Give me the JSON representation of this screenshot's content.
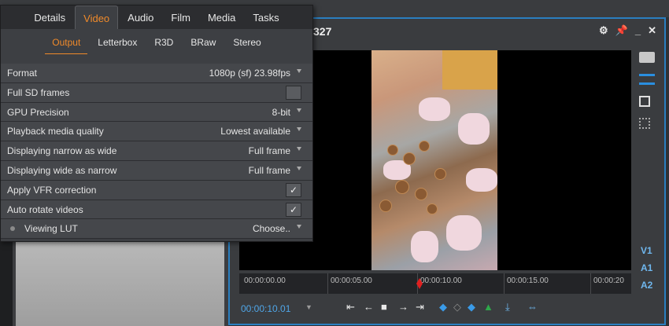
{
  "viewer": {
    "title": "327",
    "timecode": "00:00:10.01",
    "timeline_ticks": [
      "00:00:00.00",
      "00:00:05.00",
      "00:00:10.00",
      "00:00:15.00",
      "00:00:20"
    ],
    "tracks": [
      "V1",
      "A1",
      "A2"
    ],
    "transport_icons": [
      "go-to-start-icon",
      "step-back-icon",
      "stop-icon",
      "step-forward-icon",
      "go-to-end-icon",
      "mark-in-icon",
      "mark-out-icon",
      "marker-icon",
      "insert-icon",
      "overwrite-icon"
    ],
    "header_icons": [
      "gear-icon",
      "pin-icon",
      "minimize-icon",
      "close-icon"
    ]
  },
  "settings": {
    "tabs": [
      {
        "label": "Details"
      },
      {
        "label": "Video"
      },
      {
        "label": "Audio"
      },
      {
        "label": "Film"
      },
      {
        "label": "Media"
      },
      {
        "label": "Tasks"
      }
    ],
    "active_tab": "Video",
    "subtabs": [
      {
        "label": "Output"
      },
      {
        "label": "Letterbox"
      },
      {
        "label": "R3D"
      },
      {
        "label": "BRaw"
      },
      {
        "label": "Stereo"
      }
    ],
    "active_subtab": "Output",
    "rows": [
      {
        "label": "Format",
        "value": "1080p (sf) 23.98fps"
      },
      {
        "label": "Full SD frames",
        "checked": false
      },
      {
        "label": "GPU Precision",
        "value": "8-bit"
      },
      {
        "label": "Playback media quality",
        "value": "Lowest available"
      },
      {
        "label": "Displaying narrow as wide",
        "value": "Full frame"
      },
      {
        "label": "Displaying wide as narrow",
        "value": "Full frame"
      },
      {
        "label": "Apply VFR correction",
        "checked": true,
        "check_glyph": "✓"
      },
      {
        "label": "Auto rotate videos",
        "checked": true,
        "check_glyph": "✓"
      },
      {
        "label": "Viewing LUT",
        "value": "Choose.."
      }
    ]
  },
  "colors": {
    "accent": "#f08a2a",
    "viewer_border": "#2a7fc0",
    "timecode": "#4fa6e8",
    "playhead": "#e02020"
  }
}
